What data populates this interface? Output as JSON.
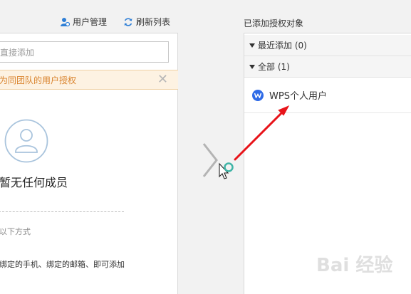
{
  "toolbar": {
    "user_manage_label": "用户管理",
    "refresh_label": "刷新列表"
  },
  "left": {
    "search_placeholder": "直接添加",
    "notice_text": "为同团队的用户授权",
    "empty_title": "暂无任何成员",
    "hint_line1": "以下方式",
    "hint_line2": "绑定的手机、绑定的邮箱、即可添加"
  },
  "right": {
    "title": "已添加授权对象",
    "groups": [
      {
        "label": "最近添加 (0)"
      },
      {
        "label": "全部 (1)"
      }
    ],
    "users": [
      {
        "name": "WPS个人用户"
      }
    ]
  },
  "watermark": "Bai 经验",
  "colors": {
    "notice_bg": "#fdf2e2",
    "notice_text": "#d9822b",
    "wps_blue": "#2f6be7",
    "arrow_red": "#e8141a"
  }
}
